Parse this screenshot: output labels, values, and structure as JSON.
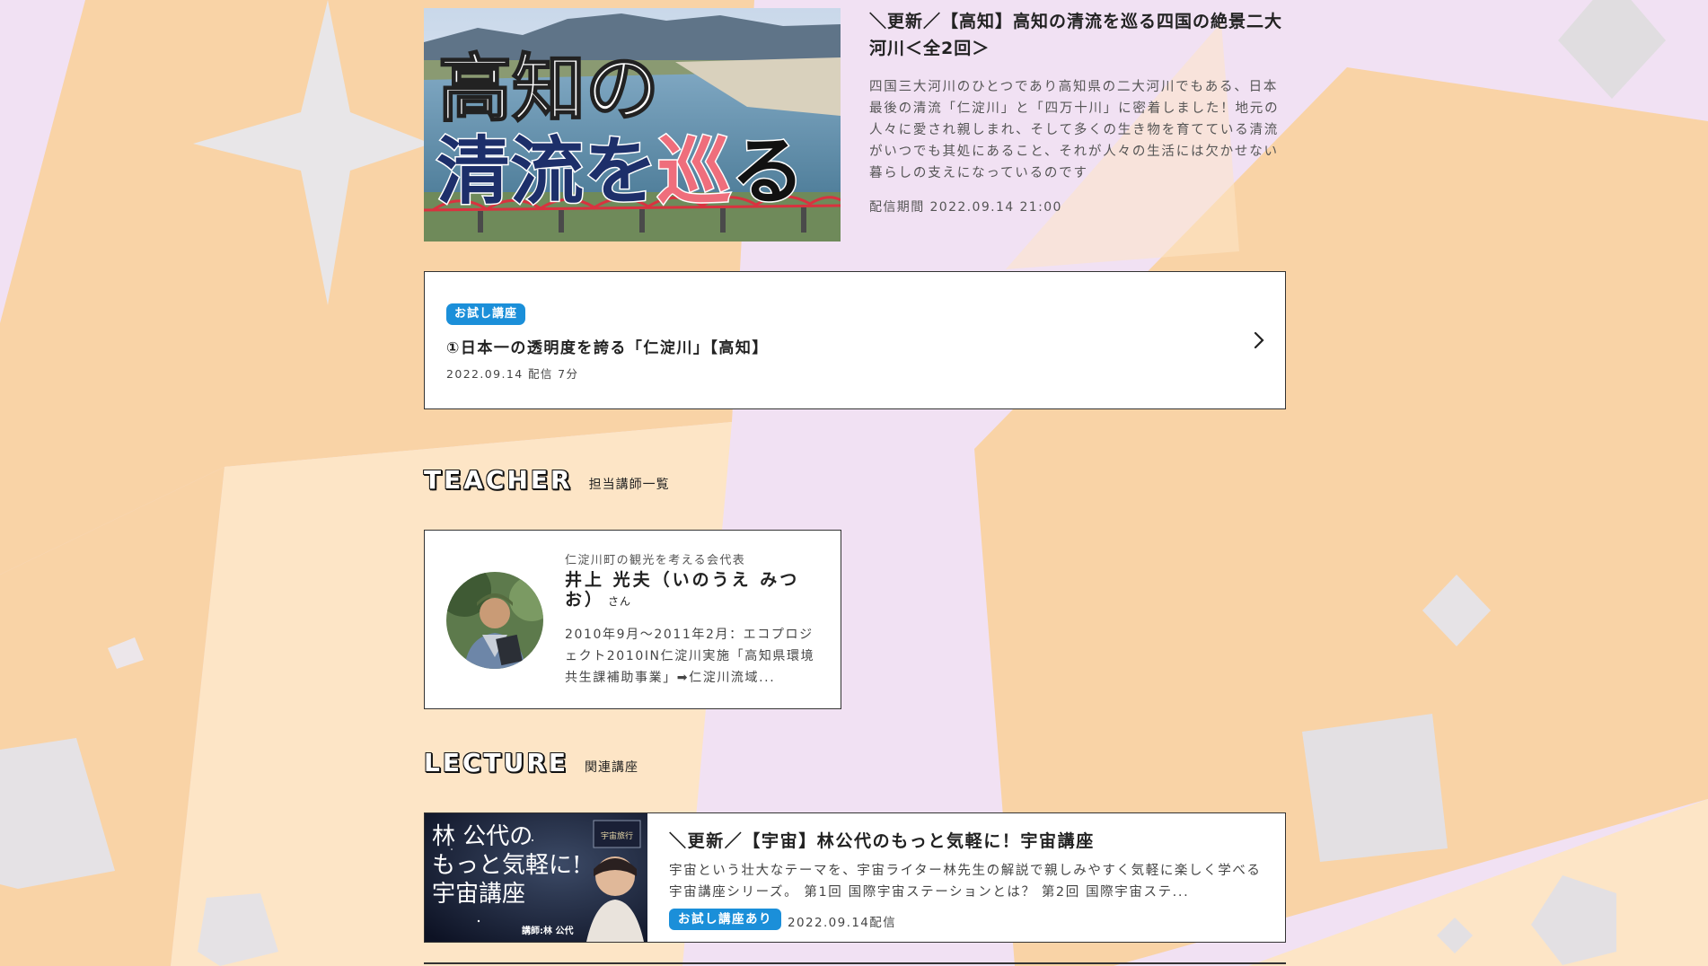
{
  "hero": {
    "thumb_line1": "高知の",
    "thumb_line2a": "清流を",
    "thumb_line2b": "巡",
    "thumb_line2c": "る",
    "title": "＼更新／【高知】高知の清流を巡る四国の絶景二大河川＜全2回＞",
    "description": "四国三大河川のひとつであり高知県の二大河川でもある、日本最後の清流「仁淀川」と「四万十川」に密着しました！地元の人々に愛され親しまれ、そして多くの生き物を育てている清流がいつでも其処にあること、それが人々の生活には欠かせない暮らしの支えになっているのです",
    "period": "配信期間 2022.09.14 21:00"
  },
  "episode": {
    "badge": "お試し講座",
    "title": "①日本一の透明度を誇る「仁淀川」【高知】",
    "meta": "2022.09.14 配信  7分"
  },
  "teacher_section": {
    "heading_en": "TEACHER",
    "heading_ja": "担当講師一覧"
  },
  "teacher": {
    "role": "仁淀川町の観光を考える会代表",
    "name": "井上 光夫（いのうえ みつお）",
    "name_suffix": "さん",
    "bio": "2010年9月～2011年2月：エコプロジェクト2010IN仁淀川実施「高知県環境共生課補助事業」➡仁淀川流域..."
  },
  "lecture_section": {
    "heading_en": "LECTURE",
    "heading_ja": "関連講座"
  },
  "lecture": {
    "thumb_line1": "林 公代の",
    "thumb_line2": "もっと気軽に!",
    "thumb_line3": "宇宙講座",
    "thumb_credit": "講師:林 公代",
    "thumb_tag": "宇宙旅行",
    "title": "＼更新／【宇宙】林公代のもっと気軽に！宇宙講座",
    "description": "宇宙という壮大なテーマを、宇宙ライター林先生の解説で親しみやすく気軽に楽しく学べる宇宙講座シリーズ。 第1回 国際宇宙ステーションとは？ 第2回 国際宇宙ステ...",
    "badge": "お試し講座あり",
    "date": "2022.09.14配信"
  },
  "colors": {
    "background_lavender": "#f1e1f3",
    "background_peach": "#f9d3a6",
    "accent_blue": "#1b8fd9",
    "highlight_red": "#ef6e7c"
  }
}
